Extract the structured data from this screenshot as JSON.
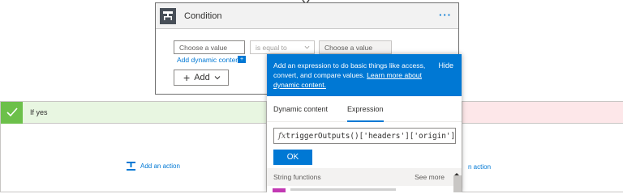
{
  "condition": {
    "title": "Condition",
    "more_label": "···",
    "value1_placeholder": "Choose a value",
    "operator": "is equal to",
    "value2_placeholder": "Choose a value",
    "dynamic_content_link": "Add dynamic content",
    "dynamic_badge": "+",
    "add_button_label": "Add"
  },
  "branches": {
    "yes_title": "If yes",
    "yes_action": "Add an action",
    "no_action": "n action"
  },
  "popup": {
    "banner_text": "Add an expression to do basic things like access, convert, and compare values.",
    "banner_link": "Learn more about dynamic content.",
    "hide_label": "Hide",
    "tabs": [
      {
        "label": "Dynamic content",
        "active": false
      },
      {
        "label": "Expression",
        "active": true
      }
    ],
    "fx_label": "fx",
    "expression": "triggerOutputs()['headers']['origin']",
    "ok_label": "OK",
    "section_title": "String functions",
    "see_more": "See more"
  },
  "colors": {
    "accent": "#0078d4",
    "yes_green": "#6cc04a",
    "yes_header_bg": "#e8f6e1",
    "no_header_bg": "#fde7e9",
    "fn_swatch": "#c239b3"
  },
  "icons": {
    "condition": "condition-icon",
    "check": "check-icon",
    "add_action": "add-action-icon",
    "chevron": "chevron-down-icon",
    "scroll": "scroll-up-icon"
  }
}
